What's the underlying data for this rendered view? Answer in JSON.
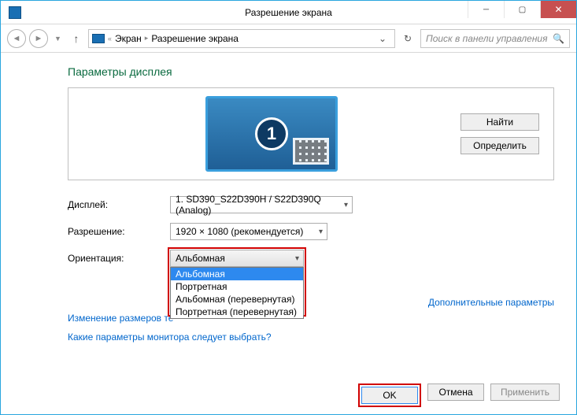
{
  "window": {
    "title": "Разрешение экрана"
  },
  "breadcrumb": {
    "item1": "Экран",
    "item2": "Разрешение экрана"
  },
  "search": {
    "placeholder": "Поиск в панели управления"
  },
  "heading": "Параметры дисплея",
  "buttons": {
    "find": "Найти",
    "detect": "Определить"
  },
  "monitor": {
    "number": "1"
  },
  "form": {
    "display_label": "Дисплей:",
    "display_value": "1. SD390_S22D390H / S22D390Q (Analog)",
    "resolution_label": "Разрешение:",
    "resolution_value": "1920 × 1080 (рекомендуется)",
    "orientation_label": "Ориентация:",
    "orientation_value": "Альбомная"
  },
  "orientation_options": {
    "o1": "Альбомная",
    "o2": "Портретная",
    "o3": "Альбомная (перевернутая)",
    "o4": "Портретная (перевернутая)"
  },
  "links": {
    "advanced": "Дополнительные параметры",
    "resize_text": "Изменение размеров те",
    "which_monitor": "Какие параметры монитора следует выбрать?"
  },
  "footer": {
    "ok": "OK",
    "cancel": "Отмена",
    "apply": "Применить"
  }
}
